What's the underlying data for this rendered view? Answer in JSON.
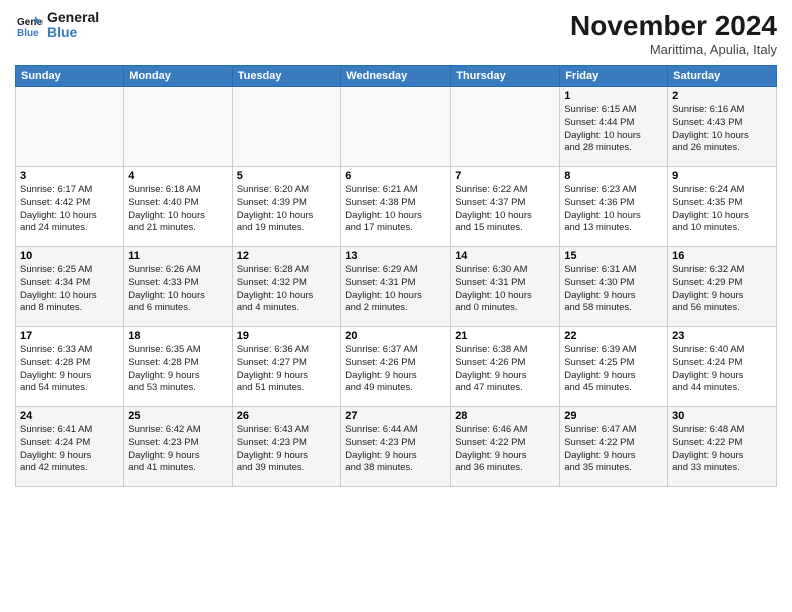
{
  "logo": {
    "line1": "General",
    "line2": "Blue"
  },
  "title": "November 2024",
  "subtitle": "Marittima, Apulia, Italy",
  "days_header": [
    "Sunday",
    "Monday",
    "Tuesday",
    "Wednesday",
    "Thursday",
    "Friday",
    "Saturday"
  ],
  "weeks": [
    [
      {
        "day": "",
        "info": ""
      },
      {
        "day": "",
        "info": ""
      },
      {
        "day": "",
        "info": ""
      },
      {
        "day": "",
        "info": ""
      },
      {
        "day": "",
        "info": ""
      },
      {
        "day": "1",
        "info": "Sunrise: 6:15 AM\nSunset: 4:44 PM\nDaylight: 10 hours\nand 28 minutes."
      },
      {
        "day": "2",
        "info": "Sunrise: 6:16 AM\nSunset: 4:43 PM\nDaylight: 10 hours\nand 26 minutes."
      }
    ],
    [
      {
        "day": "3",
        "info": "Sunrise: 6:17 AM\nSunset: 4:42 PM\nDaylight: 10 hours\nand 24 minutes."
      },
      {
        "day": "4",
        "info": "Sunrise: 6:18 AM\nSunset: 4:40 PM\nDaylight: 10 hours\nand 21 minutes."
      },
      {
        "day": "5",
        "info": "Sunrise: 6:20 AM\nSunset: 4:39 PM\nDaylight: 10 hours\nand 19 minutes."
      },
      {
        "day": "6",
        "info": "Sunrise: 6:21 AM\nSunset: 4:38 PM\nDaylight: 10 hours\nand 17 minutes."
      },
      {
        "day": "7",
        "info": "Sunrise: 6:22 AM\nSunset: 4:37 PM\nDaylight: 10 hours\nand 15 minutes."
      },
      {
        "day": "8",
        "info": "Sunrise: 6:23 AM\nSunset: 4:36 PM\nDaylight: 10 hours\nand 13 minutes."
      },
      {
        "day": "9",
        "info": "Sunrise: 6:24 AM\nSunset: 4:35 PM\nDaylight: 10 hours\nand 10 minutes."
      }
    ],
    [
      {
        "day": "10",
        "info": "Sunrise: 6:25 AM\nSunset: 4:34 PM\nDaylight: 10 hours\nand 8 minutes."
      },
      {
        "day": "11",
        "info": "Sunrise: 6:26 AM\nSunset: 4:33 PM\nDaylight: 10 hours\nand 6 minutes."
      },
      {
        "day": "12",
        "info": "Sunrise: 6:28 AM\nSunset: 4:32 PM\nDaylight: 10 hours\nand 4 minutes."
      },
      {
        "day": "13",
        "info": "Sunrise: 6:29 AM\nSunset: 4:31 PM\nDaylight: 10 hours\nand 2 minutes."
      },
      {
        "day": "14",
        "info": "Sunrise: 6:30 AM\nSunset: 4:31 PM\nDaylight: 10 hours\nand 0 minutes."
      },
      {
        "day": "15",
        "info": "Sunrise: 6:31 AM\nSunset: 4:30 PM\nDaylight: 9 hours\nand 58 minutes."
      },
      {
        "day": "16",
        "info": "Sunrise: 6:32 AM\nSunset: 4:29 PM\nDaylight: 9 hours\nand 56 minutes."
      }
    ],
    [
      {
        "day": "17",
        "info": "Sunrise: 6:33 AM\nSunset: 4:28 PM\nDaylight: 9 hours\nand 54 minutes."
      },
      {
        "day": "18",
        "info": "Sunrise: 6:35 AM\nSunset: 4:28 PM\nDaylight: 9 hours\nand 53 minutes."
      },
      {
        "day": "19",
        "info": "Sunrise: 6:36 AM\nSunset: 4:27 PM\nDaylight: 9 hours\nand 51 minutes."
      },
      {
        "day": "20",
        "info": "Sunrise: 6:37 AM\nSunset: 4:26 PM\nDaylight: 9 hours\nand 49 minutes."
      },
      {
        "day": "21",
        "info": "Sunrise: 6:38 AM\nSunset: 4:26 PM\nDaylight: 9 hours\nand 47 minutes."
      },
      {
        "day": "22",
        "info": "Sunrise: 6:39 AM\nSunset: 4:25 PM\nDaylight: 9 hours\nand 45 minutes."
      },
      {
        "day": "23",
        "info": "Sunrise: 6:40 AM\nSunset: 4:24 PM\nDaylight: 9 hours\nand 44 minutes."
      }
    ],
    [
      {
        "day": "24",
        "info": "Sunrise: 6:41 AM\nSunset: 4:24 PM\nDaylight: 9 hours\nand 42 minutes."
      },
      {
        "day": "25",
        "info": "Sunrise: 6:42 AM\nSunset: 4:23 PM\nDaylight: 9 hours\nand 41 minutes."
      },
      {
        "day": "26",
        "info": "Sunrise: 6:43 AM\nSunset: 4:23 PM\nDaylight: 9 hours\nand 39 minutes."
      },
      {
        "day": "27",
        "info": "Sunrise: 6:44 AM\nSunset: 4:23 PM\nDaylight: 9 hours\nand 38 minutes."
      },
      {
        "day": "28",
        "info": "Sunrise: 6:46 AM\nSunset: 4:22 PM\nDaylight: 9 hours\nand 36 minutes."
      },
      {
        "day": "29",
        "info": "Sunrise: 6:47 AM\nSunset: 4:22 PM\nDaylight: 9 hours\nand 35 minutes."
      },
      {
        "day": "30",
        "info": "Sunrise: 6:48 AM\nSunset: 4:22 PM\nDaylight: 9 hours\nand 33 minutes."
      }
    ]
  ]
}
